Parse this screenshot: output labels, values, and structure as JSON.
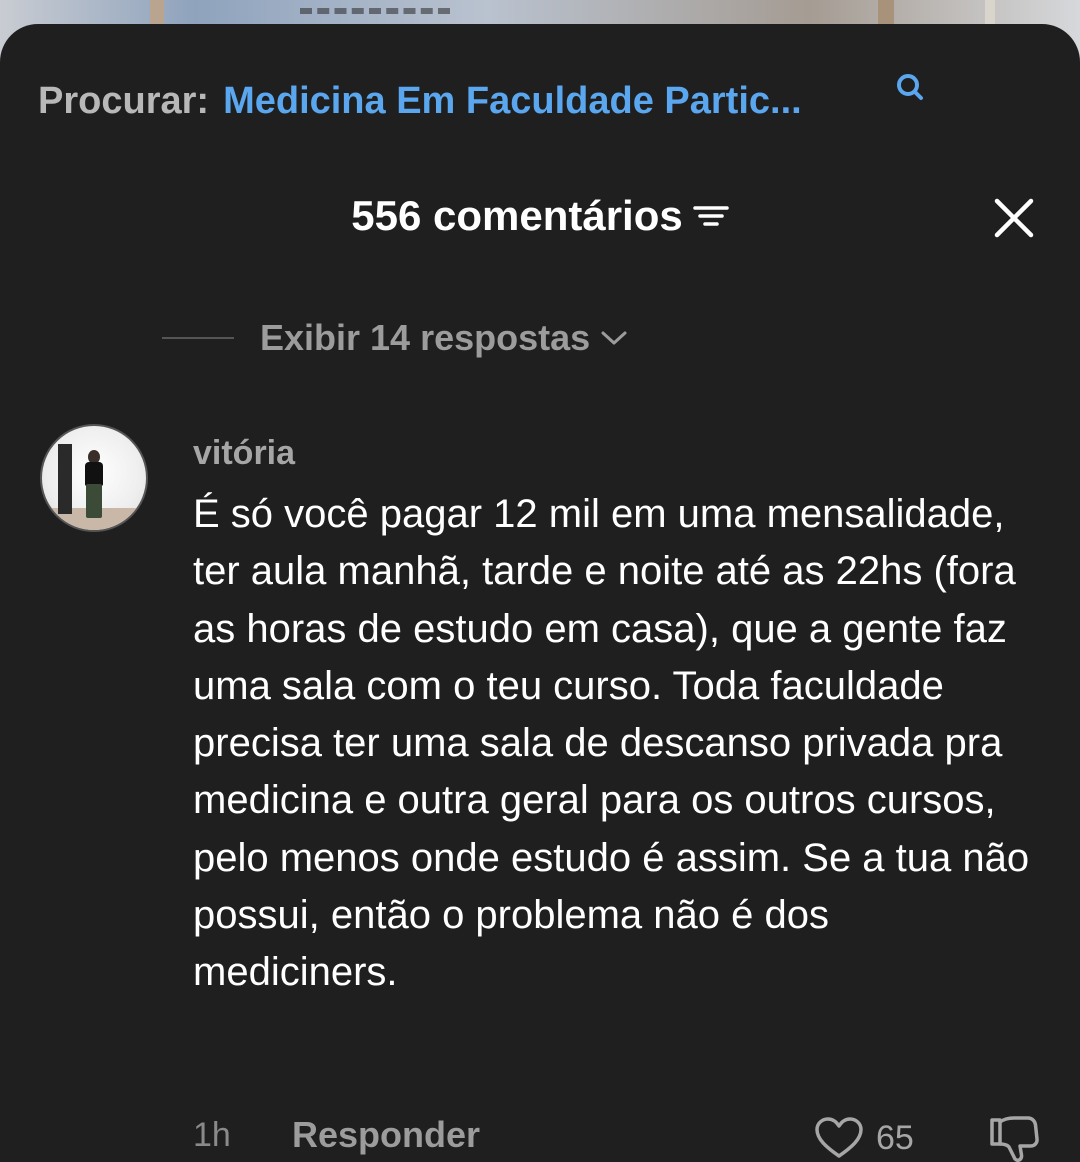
{
  "search": {
    "prefix": "Procurar:",
    "query": "Medicina Em Faculdade Partic..."
  },
  "header": {
    "title": "556 comentários"
  },
  "replies": {
    "label": "Exibir 14 respostas"
  },
  "comment": {
    "author": "vitória",
    "text": "É só você pagar 12 mil em uma mensalidade, ter aula manhã, tarde e noite até as 22hs (fora as horas de estudo em casa), que a gente faz uma sala com o teu curso. Toda faculdade precisa ter uma sala de descanso privada pra medicina e outra geral para os outros cursos, pelo menos onde estudo é assim. Se a tua não possui, então o problema não é dos mediciners.",
    "time": "1h",
    "reply_label": "Responder",
    "likes": "65"
  },
  "icons": {
    "search": "search-icon",
    "filter": "filter-icon",
    "close": "close-icon",
    "chevron": "chevron-down-icon",
    "heart": "heart-icon",
    "dislike": "thumbs-down-icon"
  },
  "colors": {
    "sheet_background": "#1f1f1f",
    "search_query": "#5aa6ef",
    "muted_text": "#9c9c9c"
  }
}
